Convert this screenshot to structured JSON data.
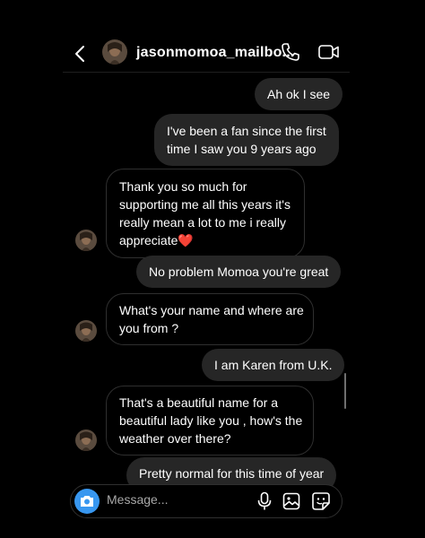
{
  "header": {
    "username": "jasonmomoa_mailbo...",
    "back_icon": "chevron-left-icon",
    "call_icon": "phone-icon",
    "video_icon": "video-camera-icon"
  },
  "messages": [
    {
      "sender": "me",
      "text": "Ah ok I see"
    },
    {
      "sender": "me",
      "lines": [
        "I've been a fan since the first",
        "time I saw you 9 years ago"
      ]
    },
    {
      "sender": "them",
      "lines": [
        "Thank you so much for",
        "supporting me all this years it's",
        "really mean a lot to me i really",
        "appreciate"
      ],
      "emoji": "❤️"
    },
    {
      "sender": "me",
      "text": "No problem Momoa you're great"
    },
    {
      "sender": "them",
      "lines": [
        "What's your name and where are",
        "you from ?"
      ]
    },
    {
      "sender": "me",
      "text": "I am Karen from U.K."
    },
    {
      "sender": "them",
      "lines": [
        "That's a beautiful name for a",
        "beautiful lady like you , how's the",
        "weather over there?"
      ]
    },
    {
      "sender": "me",
      "text": "Pretty normal for this time of year"
    }
  ],
  "composer": {
    "placeholder": "Message...",
    "camera_icon": "camera-icon",
    "mic_icon": "microphone-icon",
    "gallery_icon": "image-icon",
    "sticker_icon": "sticker-icon"
  },
  "colors": {
    "background": "#000000",
    "outgoing_bubble": "#262626",
    "incoming_border": "#2f2f2f",
    "camera_button": "#3897f0"
  }
}
